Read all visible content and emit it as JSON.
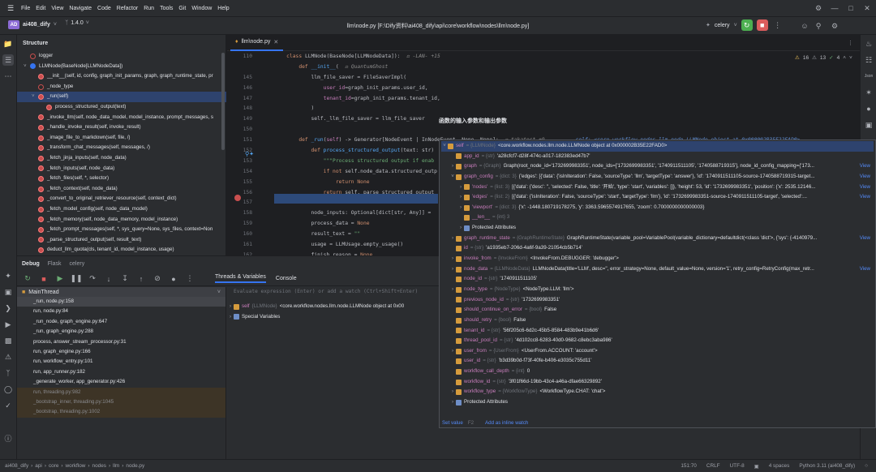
{
  "menu": [
    "File",
    "Edit",
    "View",
    "Navigate",
    "Code",
    "Refactor",
    "Run",
    "Tools",
    "Git",
    "Window",
    "Help"
  ],
  "project": {
    "badge": "AD",
    "name": "ai408_dify",
    "branch": "1.4.0"
  },
  "file_path": "llm\\node.py [F:\\Dify资料\\ai408_dify\\api\\core\\workflow\\nodes\\llm\\node.py]",
  "run_config": "celery",
  "structure": {
    "title": "Structure",
    "items": [
      {
        "label": "logger",
        "icon": "field",
        "indent": 0
      },
      {
        "label": "LLMNode(BaseNode[LLMNodeData])",
        "icon": "class",
        "indent": 0
      },
      {
        "label": "__init__(self, id, config, graph_init_params, graph, graph_runtime_state, pr",
        "icon": "method",
        "indent": 1
      },
      {
        "label": "_node_type",
        "icon": "field",
        "indent": 1
      },
      {
        "label": "_run(self)",
        "icon": "method",
        "indent": 1,
        "selected": true
      },
      {
        "label": "process_structured_output(text)",
        "icon": "fn",
        "indent": 2
      },
      {
        "label": "_invoke_llm(self, node_data_model, model_instance, prompt_messages, s",
        "icon": "method",
        "indent": 1
      },
      {
        "label": "_handle_invoke_result(self, invoke_result)",
        "icon": "method",
        "indent": 1
      },
      {
        "label": "_image_file_to_markdown(self, file, /)",
        "icon": "method",
        "indent": 1
      },
      {
        "label": "_transform_chat_messages(self, messages, /)",
        "icon": "method",
        "indent": 1
      },
      {
        "label": "_fetch_jinja_inputs(self, node_data)",
        "icon": "method",
        "indent": 1
      },
      {
        "label": "_fetch_inputs(self, node_data)",
        "icon": "method",
        "indent": 1
      },
      {
        "label": "_fetch_files(self, *, selector)",
        "icon": "method",
        "indent": 1
      },
      {
        "label": "_fetch_context(self, node_data)",
        "icon": "method",
        "indent": 1
      },
      {
        "label": "_convert_to_original_retriever_resource(self, context_dict)",
        "icon": "method",
        "indent": 1
      },
      {
        "label": "_fetch_model_config(self, node_data_model)",
        "icon": "method",
        "indent": 1
      },
      {
        "label": "_fetch_memory(self, node_data_memory, model_instance)",
        "icon": "method",
        "indent": 1
      },
      {
        "label": "_fetch_prompt_messages(self, *, sys_query=None, sys_files, context=Non",
        "icon": "method",
        "indent": 1
      },
      {
        "label": "_parse_structured_output(self, result_text)",
        "icon": "method",
        "indent": 1
      },
      {
        "label": "deduct_llm_quota(cls, tenant_id, model_instance, usage)",
        "icon": "method",
        "indent": 1
      },
      {
        "label": "_extract_variable_selector_to_variable_mapping(cls, *, graph_config, node",
        "icon": "method",
        "indent": 1
      }
    ]
  },
  "editor": {
    "tab": "llm\\node.py",
    "inspections": {
      "warnings": "16",
      "weak": "13",
      "typos": "4"
    },
    "lines": [
      {
        "n": "110",
        "html": "    <span class='kw'>class</span> <span class='cls'>LLMNode</span>(BaseNode[LLMNodeData]):  <span class='hint'>&#9878; -LAN- +15</span>"
      },
      {
        "n": "",
        "html": "        <span class='kw'>def</span> <span class='fn'>__init__</span>(  <span class='hint'>&#9878; QuantumGhost</span>"
      },
      {
        "n": "145",
        "html": "            llm_file_saver = FileSaverImpl("
      },
      {
        "n": "146",
        "html": "                <span class='pm'>user_id</span>=graph_init_params.user_id,"
      },
      {
        "n": "147",
        "html": "                <span class='pm'>tenant_id</span>=graph_init_params.tenant_id,"
      },
      {
        "n": "148",
        "html": "            )"
      },
      {
        "n": "149",
        "html": "            self._llm_file_saver = llm_file_saver"
      },
      {
        "n": "150",
        "html": ""
      },
      {
        "n": "151",
        "html": "        <span class='kw'>def</span> <span class='fn'>_run</span>(<span class='pm'>self</span>) -&gt; Generator[NodeEvent | InNodeEvent, None, None]:  <span class='hint'>&#9878; takatost +9</span>          <span class='inl'>self: &lt;core.workflow.nodes.llm.node.LLMNode object at 0x000002B35E22FAD0&gt;</span>"
      },
      {
        "n": "152",
        "html": "            <span class='kw'>def</span> <span class='fn'>process_structured_output</span>(text: str)"
      },
      {
        "n": "153",
        "html": "                <span class='st'>\"\"\"Process structured output if enab</span>"
      },
      {
        "n": "154",
        "html": "                <span class='kw'>if not</span> self.node_data.structured_outp"
      },
      {
        "n": "155",
        "html": "                    <span class='kw'>return</span> <span class='kw'>None</span>"
      },
      {
        "n": "156",
        "html": "                <span class='kw'>return</span> self._parse_structured_output"
      },
      {
        "n": "157",
        "html": ""
      },
      {
        "n": "158",
        "html": "            node_inputs: Optional[dict[str, Any]] = "
      },
      {
        "n": "159",
        "html": "            process_data = <span class='kw'>None</span>"
      },
      {
        "n": "160",
        "html": "            result_text = <span class='st'>\"\"</span>"
      },
      {
        "n": "161",
        "html": "            usage = LLMUsage.empty_usage()"
      },
      {
        "n": "162",
        "html": "            finish_reason = <span class='kw'>None</span>"
      }
    ]
  },
  "debug": {
    "tabs": [
      "Debug",
      "Flask",
      "celery"
    ],
    "subtabs": [
      "Threads & Variables",
      "Console"
    ],
    "thread": "MainThread",
    "eval_placeholder": "Evaluate expression (Enter) or add a watch (Ctrl+Shift+Enter)",
    "frames": [
      {
        "label": "_run, node.py:158",
        "sel": true
      },
      {
        "label": "run, node.py:84"
      },
      {
        "label": "_run_node, graph_engine.py:647"
      },
      {
        "label": "_run, graph_engine.py:288"
      },
      {
        "label": "process, answer_stream_processor.py:31"
      },
      {
        "label": "run, graph_engine.py:166"
      },
      {
        "label": "run, workflow_entry.py:101"
      },
      {
        "label": "run, app_runner.py:182"
      },
      {
        "label": "_generate_worker, app_generator.py:426"
      },
      {
        "label": "run, threading.py:982",
        "lib": true
      },
      {
        "label": "_bootstrap_inner, threading.py:1045",
        "lib": true
      },
      {
        "label": "_bootstrap, threading.py:1002",
        "lib": true
      }
    ],
    "vars": [
      {
        "name": "self",
        "type": "{LLMNode}",
        "value": "<core.workflow.nodes.llm.node.LLMNode object at 0x00"
      },
      {
        "name": "Special Variables",
        "type": "",
        "value": ""
      }
    ]
  },
  "annotation": "函数的输入参数和输出参数",
  "popup": {
    "rows": [
      {
        "d": 0,
        "arr": "v",
        "name": "self",
        "type": "= {LLMNode}",
        "val": "<core.workflow.nodes.llm.node.LLMNode object at 0x000002B35E22FAD0>",
        "view": ""
      },
      {
        "d": 1,
        "arr": "",
        "name": "app_id",
        "type": "= {str}",
        "val": "'a28cfcf7-d28f-474c-a017-182383ed47b7'",
        "view": ""
      },
      {
        "d": 1,
        "arr": ">",
        "name": "graph",
        "type": "= {Graph}",
        "val": "Graph(root_node_id='1732699983351', node_ids=['1732699983351', '1740911511105', '1740588719315'], node_id_config_mapping={'173...",
        "view": "View"
      },
      {
        "d": 1,
        "arr": "v",
        "name": "graph_config",
        "type": "= {dict: 3}",
        "val": "{'edges': [{'data': {'isInIteration': False, 'sourceType': 'llm', 'targetType': 'answer'}, 'id': '1740911511105-source-1740588719315-target...",
        "view": "View"
      },
      {
        "d": 2,
        "arr": ">",
        "name": "'nodes'",
        "type": "= {list: 3}",
        "val": "[{'data': {'desc': '', 'selected': False, 'title': '开始', 'type': 'start', 'variables': []}, 'height': 53, 'id': '1732699983351', 'position': {'x': 2535.12146...",
        "view": "View"
      },
      {
        "d": 2,
        "arr": ">",
        "name": "'edges'",
        "type": "= {list: 2}",
        "val": "[{'data': {'isInIteration': False, 'sourceType': 'start', 'targetType': 'llm'}, 'id': '1732699983351-source-1740911511105-target', 'selected':...",
        "view": "View"
      },
      {
        "d": 2,
        "arr": ">",
        "name": "'viewport'",
        "type": "= {dict: 3}",
        "val": "{'x': -1448.180719178275, 'y': 3363.5965574917655, 'zoom': 0.7000000000000003}",
        "view": ""
      },
      {
        "d": 2,
        "arr": "",
        "name": "__len__",
        "type": "= {int} 3",
        "val": "",
        "view": ""
      },
      {
        "d": 2,
        "arr": ">",
        "name": "Protected Attributes",
        "type": "",
        "val": "",
        "view": ""
      },
      {
        "d": 1,
        "arr": ">",
        "name": "graph_runtime_state",
        "type": "= {GraphRuntimeState}",
        "val": "GraphRuntimeState(variable_pool=VariablePool(variable_dictionary=defaultdict(<class 'dict'>, {'sys': {-4140979...",
        "view": "View"
      },
      {
        "d": 1,
        "arr": "",
        "name": "id",
        "type": "= {str}",
        "val": "'a1935eb7-206d-4a6f-9a39-21054cb5b714'",
        "view": ""
      },
      {
        "d": 1,
        "arr": ">",
        "name": "invoke_from",
        "type": "= {InvokeFrom}",
        "val": "<InvokeFrom.DEBUGGER: 'debugger'>",
        "view": ""
      },
      {
        "d": 1,
        "arr": ">",
        "name": "node_data",
        "type": "= {LLMNodeData}",
        "val": "LLMNodeData(title='LLM', desc='', error_strategy=None, default_value=None, version='1', retry_config=RetryConfig(max_retr...",
        "view": "View"
      },
      {
        "d": 1,
        "arr": "",
        "name": "node_id",
        "type": "= {str}",
        "val": "'1740911511105'",
        "view": ""
      },
      {
        "d": 1,
        "arr": ">",
        "name": "node_type",
        "type": "= {NodeType}",
        "val": "<NodeType.LLM: 'llm'>",
        "view": ""
      },
      {
        "d": 1,
        "arr": "",
        "name": "previous_node_id",
        "type": "= {str}",
        "val": "'1732699983351'",
        "view": ""
      },
      {
        "d": 1,
        "arr": "",
        "name": "should_continue_on_error",
        "type": "= {bool}",
        "val": "False",
        "view": ""
      },
      {
        "d": 1,
        "arr": "",
        "name": "should_retry",
        "type": "= {bool}",
        "val": "False",
        "view": ""
      },
      {
        "d": 1,
        "arr": "",
        "name": "tenant_id",
        "type": "= {str}",
        "val": "'56f205c6-6d2c-45b5-8584-483b9e41b6d6'",
        "view": ""
      },
      {
        "d": 1,
        "arr": "",
        "name": "thread_pool_id",
        "type": "= {str}",
        "val": "'4d102cc8-6283-40d0-9682-c8ebc3aba986'",
        "view": ""
      },
      {
        "d": 1,
        "arr": ">",
        "name": "user_from",
        "type": "= {UserFrom}",
        "val": "<UserFrom.ACCOUNT: 'account'>",
        "view": ""
      },
      {
        "d": 1,
        "arr": "",
        "name": "user_id",
        "type": "= {str}",
        "val": "'b3d39b0d-f73f-40fe-b406-e3035c755d11'",
        "view": ""
      },
      {
        "d": 1,
        "arr": "",
        "name": "workflow_call_depth",
        "type": "= {int}",
        "val": "0",
        "view": ""
      },
      {
        "d": 1,
        "arr": "",
        "name": "workflow_id",
        "type": "= {str}",
        "val": "'3f01f66d-19bb-43c4-a46a-dfae66329892'",
        "view": ""
      },
      {
        "d": 1,
        "arr": ">",
        "name": "workflow_type",
        "type": "= {WorkflowType}",
        "val": "<WorkflowType.CHAT: 'chat'>",
        "view": ""
      },
      {
        "d": 1,
        "arr": ">",
        "name": "Protected Attributes",
        "type": "",
        "val": "",
        "view": ""
      }
    ],
    "footer": {
      "set_value": "Set value",
      "shortcut": "F2",
      "add_watch": "Add as inline watch"
    }
  },
  "breadcrumb": [
    "ai408_dify",
    "api",
    "core",
    "workflow",
    "nodes",
    "llm",
    "node.py"
  ],
  "status": {
    "pos": "151:70",
    "eol": "CRLF",
    "enc": "UTF-8",
    "indent": "4 spaces",
    "interp": "Python 3.11 (ai408_dify)"
  },
  "colors": {
    "accent": "#3574f0",
    "breakpoint": "#c94f4f",
    "run": "#4caf50",
    "stop": "#db5c5c"
  }
}
